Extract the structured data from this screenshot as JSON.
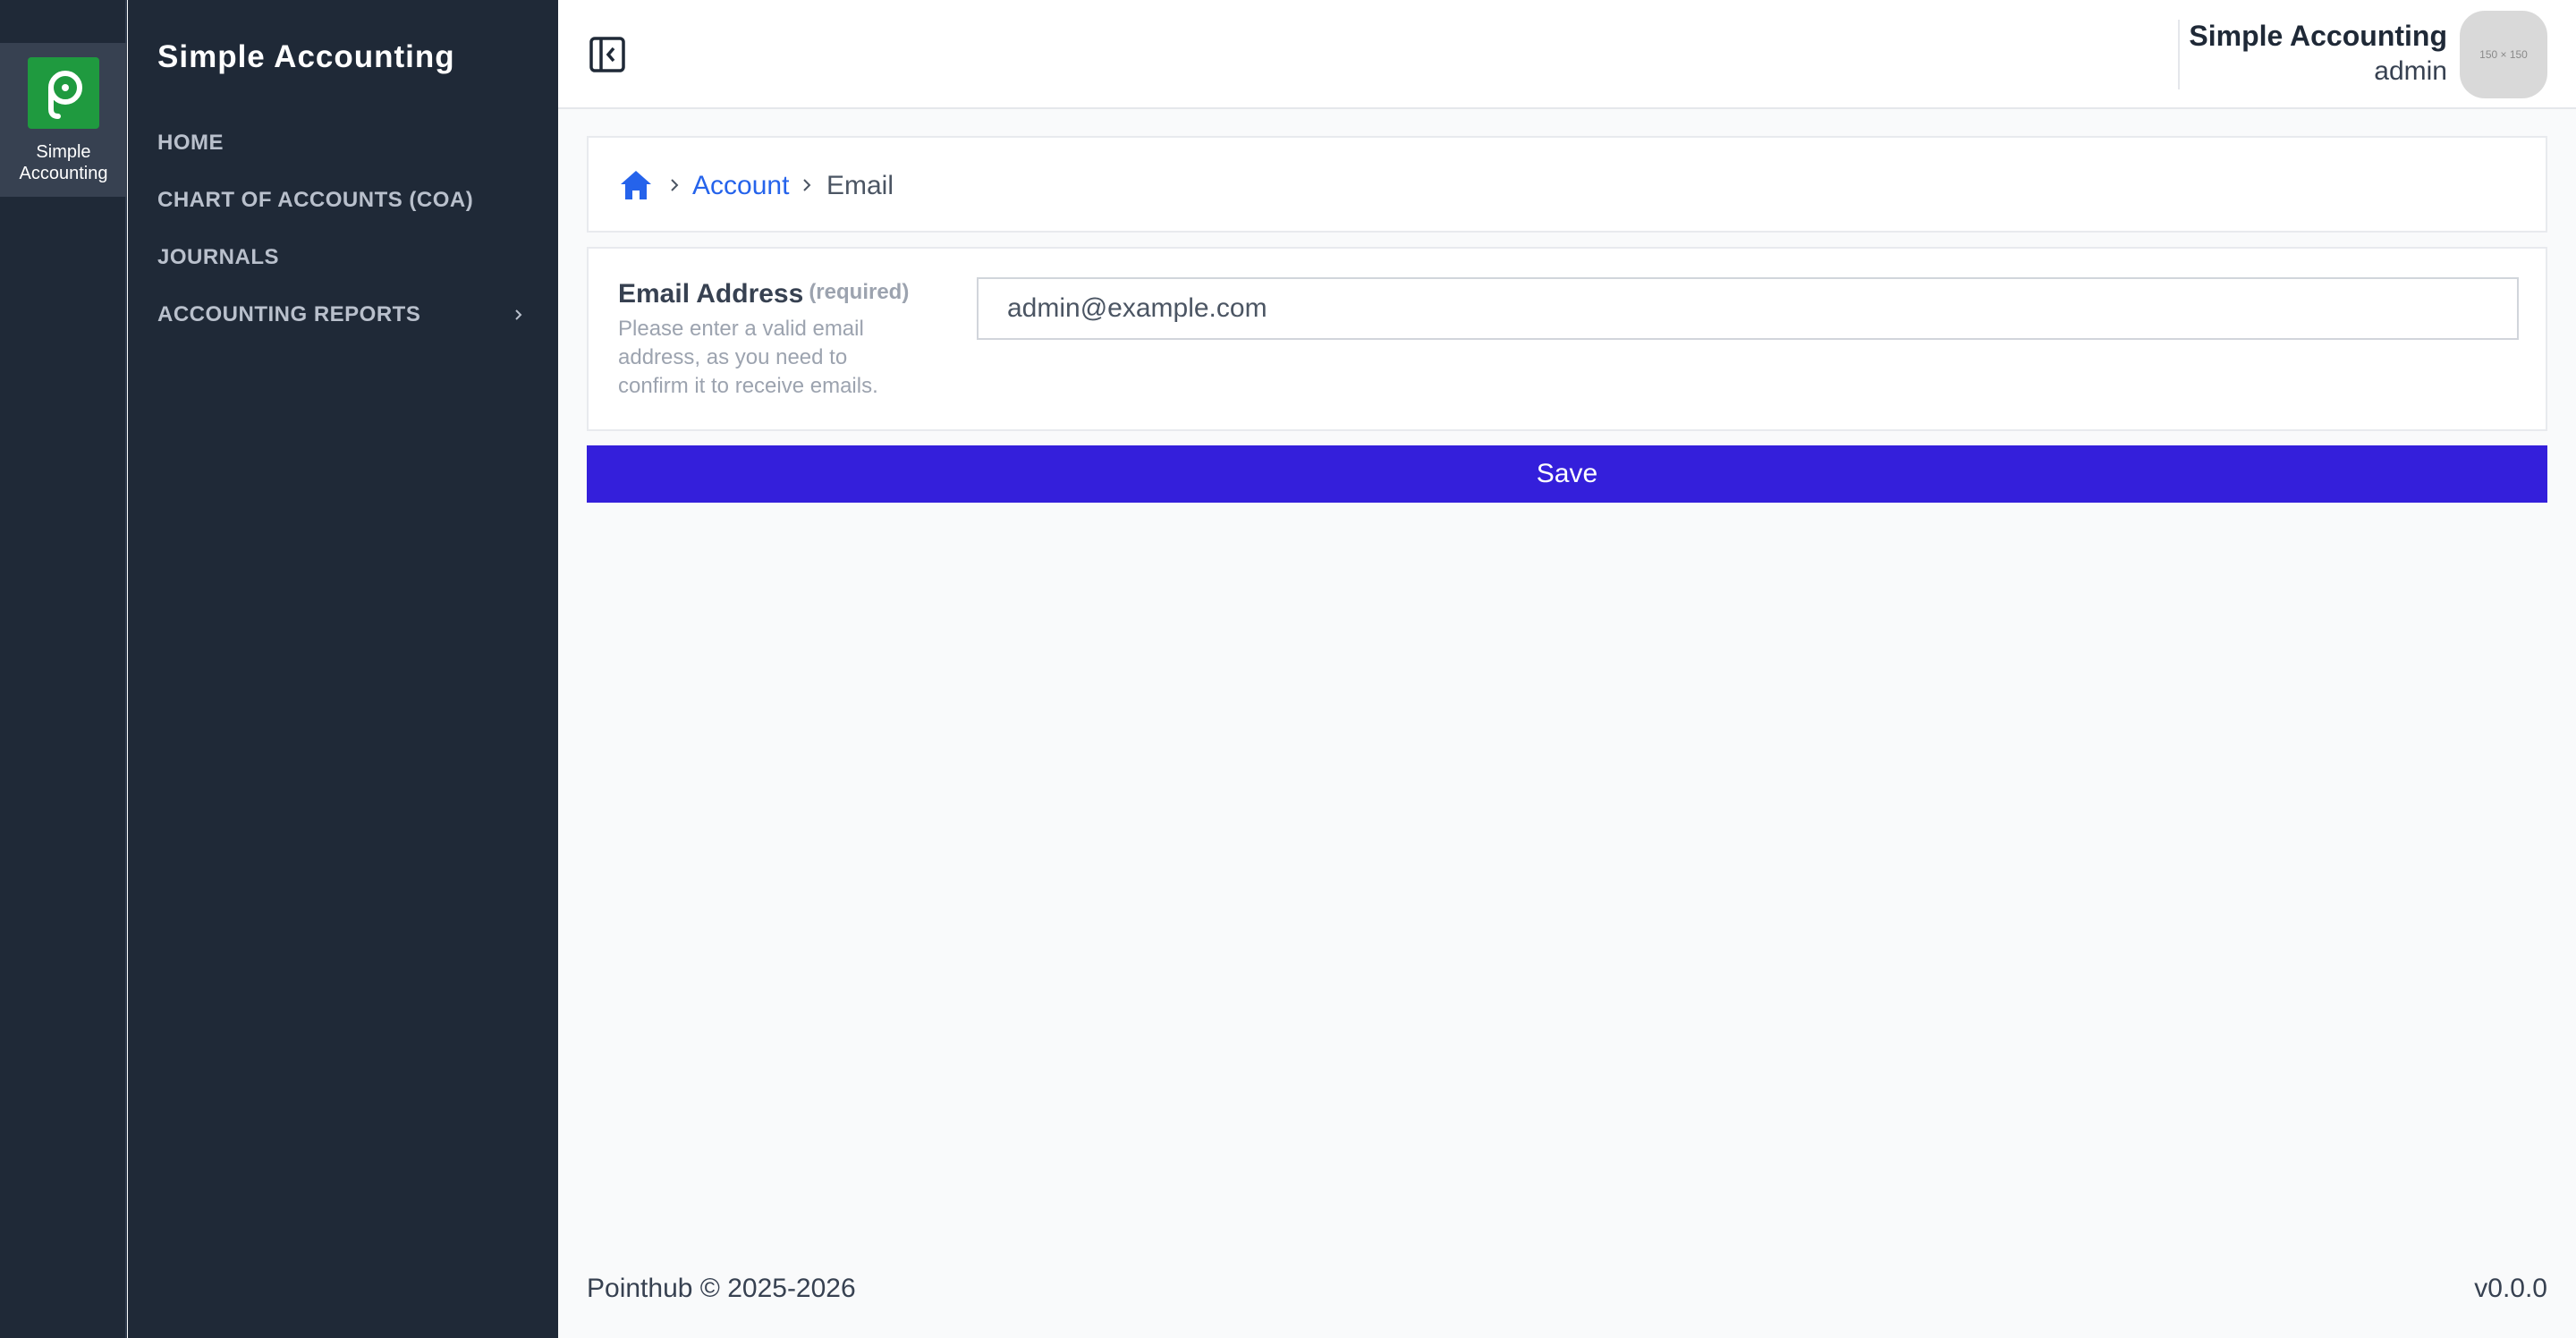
{
  "rail": {
    "app_label": "Simple\nAccounting",
    "logo_color": "#1f9a3f"
  },
  "sidebar": {
    "title": "Simple Accounting",
    "items": [
      {
        "label": "HOME",
        "icon": null
      },
      {
        "label": "CHART OF ACCOUNTS (COA)",
        "icon": null
      },
      {
        "label": "JOURNALS",
        "icon": null
      },
      {
        "label": "ACCOUNTING REPORTS",
        "icon": "chevron-right-icon"
      }
    ]
  },
  "header": {
    "collapse_icon": "sidebar-collapse-icon",
    "user_name": "Simple Accounting",
    "user_role": "admin",
    "avatar_placeholder": "150 × 150"
  },
  "breadcrumb": {
    "home_icon": "home-icon",
    "items": [
      "Account",
      "Email"
    ]
  },
  "form": {
    "email_label": "Email Address",
    "required_label": "(required)",
    "help_text": "Please enter a valid email address, as you need to confirm it to receive emails.",
    "email_value": "admin@example.com"
  },
  "actions": {
    "save_label": "Save",
    "save_color": "#341fdb"
  },
  "footer": {
    "copyright": "Pointhub © 2025-2026",
    "version": "v0.0.0"
  },
  "colors": {
    "sidebar_bg": "#1f2937",
    "link": "#2563eb",
    "page_bg": "#f9fafb"
  }
}
